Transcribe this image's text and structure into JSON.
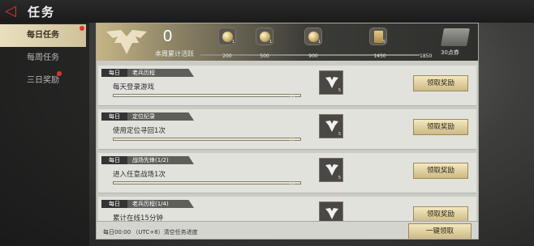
{
  "header": {
    "title": "任务"
  },
  "sidebar": {
    "items": [
      {
        "label": "每日任务"
      },
      {
        "label": "每周任务"
      },
      {
        "label": "三日奖励"
      }
    ]
  },
  "activity": {
    "points": "0",
    "label": "本周累计活跃",
    "milestones": [
      {
        "value": "200",
        "count": "1"
      },
      {
        "value": "500",
        "count": "1"
      },
      {
        "value": "900",
        "count": "1"
      },
      {
        "value": "1450",
        "count": "5"
      }
    ],
    "final_value": "1850",
    "final_reward": "30点券"
  },
  "tasks": [
    {
      "daily": "每日",
      "category": "老兵历程",
      "desc": "每天登录游戏",
      "progress": "1/1",
      "qty": "5",
      "button": "领取奖励"
    },
    {
      "daily": "每日",
      "category": "定位纪录",
      "desc": "使用定位寻回1次",
      "progress": "1/1",
      "qty": "5",
      "button": "领取奖励"
    },
    {
      "daily": "每日",
      "category": "战场先锋(1/2)",
      "desc": "进入任意战场1次",
      "progress": "1/1",
      "qty": "5",
      "button": "领取奖励"
    },
    {
      "daily": "每日",
      "category": "老兵历程(1/4)",
      "desc": "累计在线15分钟",
      "progress": "",
      "qty": "",
      "button": "领取奖励"
    }
  ],
  "footer": {
    "note": "每日00:00 （UTC+8）清空任务进度",
    "claim_all": "一键领取"
  },
  "colors": {
    "accent": "#d43b2a",
    "gold": "#cdb985"
  }
}
